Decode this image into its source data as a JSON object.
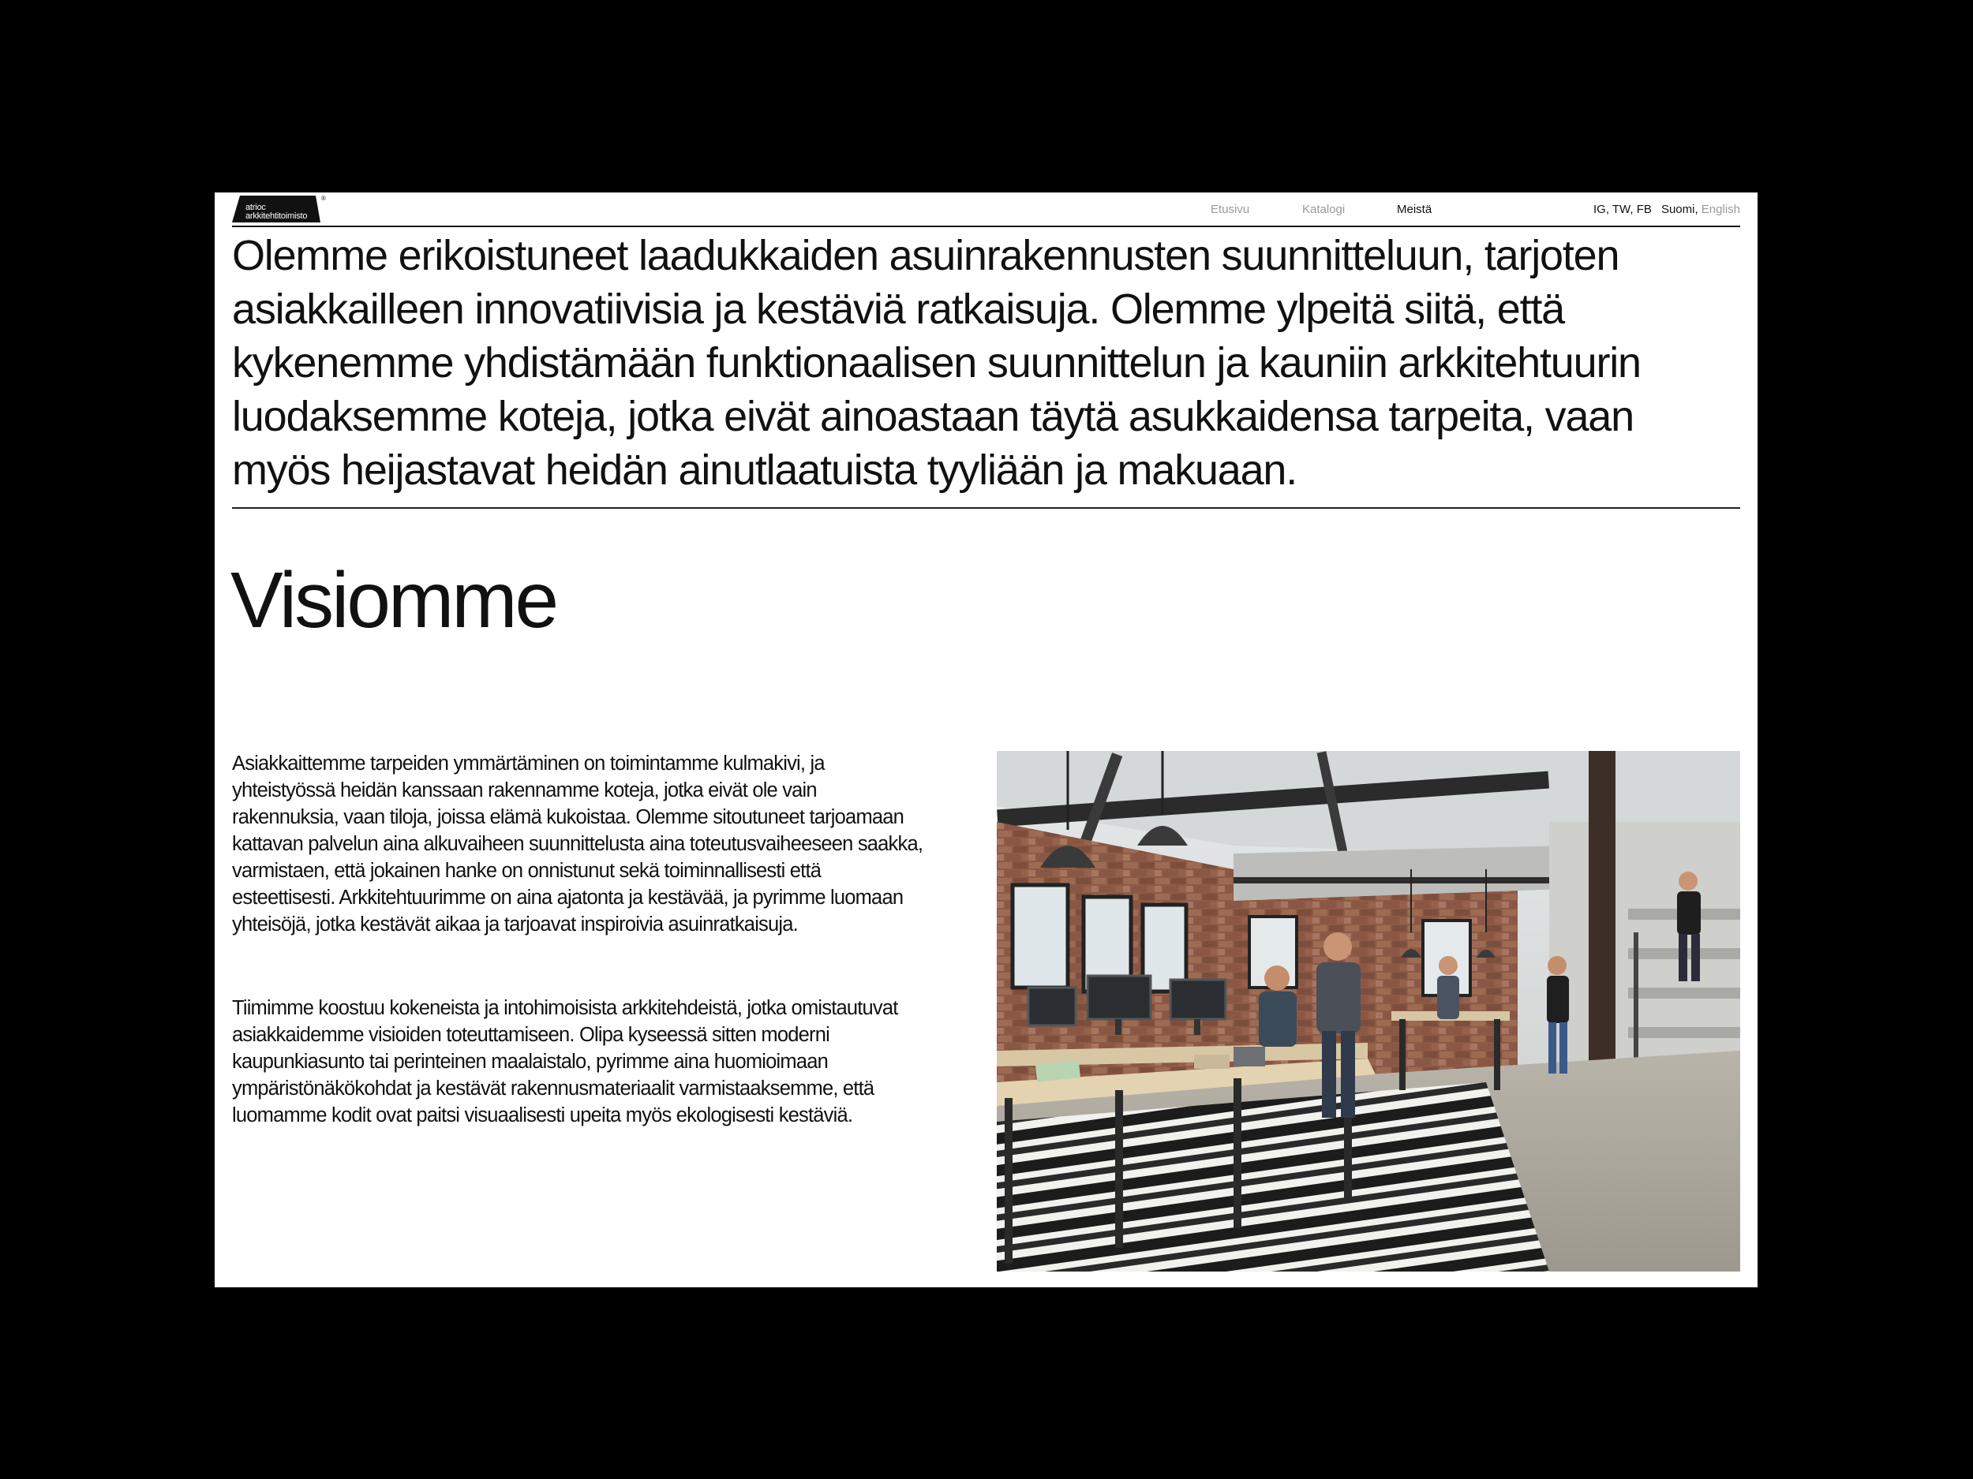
{
  "header": {
    "logo": {
      "line1": "atrioc",
      "line2": "arkkitehtitoimisto",
      "registered": "®"
    },
    "nav": [
      {
        "label": "Etusivu",
        "active": false
      },
      {
        "label": "Katalogi",
        "active": false
      },
      {
        "label": "Meistä",
        "active": true
      }
    ],
    "social": "IG, TW, FB",
    "language": {
      "current": "Suomi,",
      "alternate": "English"
    }
  },
  "intro": {
    "text": "Olemme erikoistuneet laadukkaiden asuinrakennusten suunnitteluun, tarjoten asiakkailleen innovatiivisia ja kestäviä ratkaisuja. Olemme ylpeitä siitä, että kykenemme yhdistämään funktionaalisen suunnittelun ja kauniin arkkitehtuurin luodaksemme koteja, jotka eivät ainoastaan täytä asukkaidensa tarpeita, vaan myös heijastavat heidän ainutlaatuista tyyliään ja makuaan."
  },
  "vision": {
    "title": "Visiomme",
    "paragraph1": "Asiakkaittemme tarpeiden ymmärtäminen on toimintamme kulmakivi, ja yhteistyössä heidän kanssaan rakennamme koteja, jotka eivät ole vain rakennuksia, vaan tiloja, joissa elämä kukoistaa. Olemme sitoutuneet tarjoamaan kattavan palvelun aina alkuvaiheen suunnittelusta aina toteutusvaiheeseen saakka, varmistaen, että jokainen hanke on onnistunut sekä toiminnallisesti että esteettisesti. Arkkitehtuurimme on aina ajatonta ja kestävää, ja pyrimme luomaan yhteisöjä, jotka kestävät aikaa ja tarjoavat inspiroivia asuinratkaisuja.",
    "paragraph2": "Tiimimme koostuu kokeneista ja intohimoisista arkkitehdeistä, jotka omistautuvat asiakkaidemme visioiden toteuttamiseen. Olipa kyseessä sitten moderni kaupunkiasunto tai perinteinen maalaistalo, pyrimme aina huomioimaan ympäristönäkökohdat ja kestävät rakennusmateriaalit varmistaaksemme, että luomamme kodit ovat paitsi visuaalisesti upeita myös ekologisesti kestäviä."
  },
  "colors": {
    "background": "#000000",
    "page": "#ffffff",
    "text": "#111111",
    "muted": "#9a9a9a"
  },
  "photo": {
    "icon": "office-photo"
  }
}
